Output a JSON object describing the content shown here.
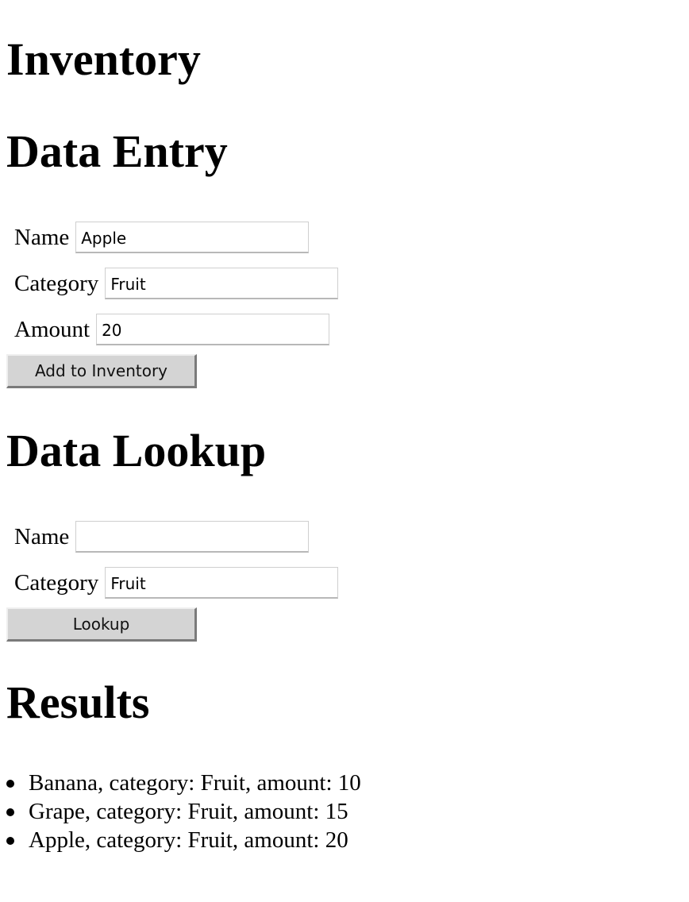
{
  "headings": {
    "title": "Inventory",
    "entry": "Data Entry",
    "lookup": "Data Lookup",
    "results": "Results"
  },
  "entry": {
    "name_label": "Name",
    "name_value": "Apple",
    "category_label": "Category",
    "category_value": "Fruit",
    "amount_label": "Amount",
    "amount_value": "20",
    "submit_label": "Add to Inventory"
  },
  "lookup": {
    "name_label": "Name",
    "name_value": "",
    "category_label": "Category",
    "category_value": "Fruit",
    "submit_label": "Lookup"
  },
  "results": [
    "Banana, category: Fruit, amount: 10",
    "Grape, category: Fruit, amount: 15",
    "Apple, category: Fruit, amount: 20"
  ]
}
